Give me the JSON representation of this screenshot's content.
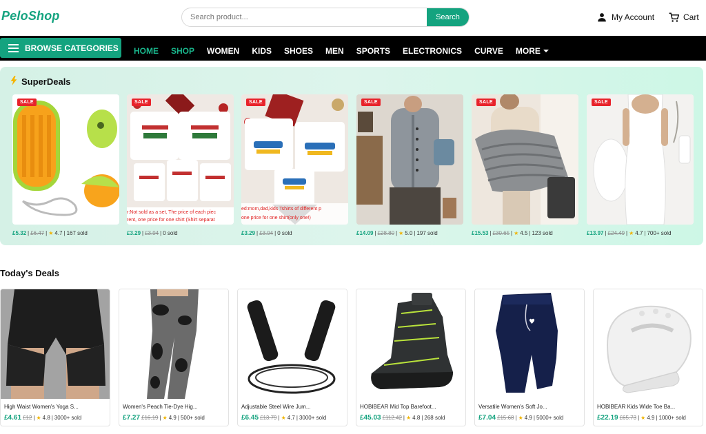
{
  "header": {
    "logo": "PeloShop",
    "search_placeholder": "Search product...",
    "search_button": "Search",
    "account_label": "My Account",
    "cart_label": "Cart"
  },
  "nav": {
    "browse_label": "BROWSE CATEGORIES",
    "items": [
      "HOME",
      "SHOP",
      "WOMEN",
      "KIDS",
      "SHOES",
      "MEN",
      "SPORTS",
      "ELECTRONICS",
      "CURVE",
      "MORE"
    ],
    "active_items": [
      "HOME",
      "SHOP"
    ]
  },
  "superdeals": {
    "title": "SuperDeals",
    "badge": "SALE",
    "items": [
      {
        "price": "£5.32",
        "old_price": "£6.47",
        "rating": "4.7",
        "sold": "167 sold",
        "image": "steam-pet-brush"
      },
      {
        "price": "£3.29",
        "old_price": "£3.94",
        "rating": "",
        "sold": "0 sold",
        "image": "family-christmas-tshirts",
        "overlay": "r:Not sold as a set, The price of each piec\nrent, one price for one shirt (Shirt separat"
      },
      {
        "price": "£3.29",
        "old_price": "£3.94",
        "rating": "",
        "sold": "0 sold",
        "image": "hello-2026-tshirts",
        "overlay": "ed:mom,dad,kids Tshirts of different p\none price for one shirt(only one!)"
      },
      {
        "price": "£14.09",
        "old_price": "£28.80",
        "rating": "5.0",
        "sold": "197 sold",
        "image": "grey-cardigan"
      },
      {
        "price": "£15.53",
        "old_price": "£30.65",
        "rating": "4.5",
        "sold": "123 sold",
        "image": "grey-blanket"
      },
      {
        "price": "£13.97",
        "old_price": "£24.49",
        "rating": "4.7",
        "sold": "700+ sold",
        "image": "white-dress"
      }
    ]
  },
  "todays_deals": {
    "title": "Today's Deals",
    "items": [
      {
        "name": "High Waist Women's Yoga S...",
        "price": "£4.61",
        "old_price": "£12",
        "rating": "4.8",
        "sold": "3000+ sold",
        "image": "black-yoga-shorts"
      },
      {
        "name": "Women's Peach Tie-Dye Hig...",
        "price": "£7.27",
        "old_price": "£16.19",
        "rating": "4.9",
        "sold": "500+ sold",
        "image": "tie-dye-leggings"
      },
      {
        "name": "Adjustable Steel Wire Jum...",
        "price": "£6.45",
        "old_price": "£13.79",
        "rating": "4.7",
        "sold": "3000+ sold",
        "image": "jump-rope"
      },
      {
        "name": "HOBIBEAR Mid Top Barefoot...",
        "price": "£45.03",
        "old_price": "£112.42",
        "rating": "4.8",
        "sold": "268 sold",
        "image": "hiking-shoe"
      },
      {
        "name": "Versatile Women's Soft Jo...",
        "price": "£7.04",
        "old_price": "£15.68",
        "rating": "4.9",
        "sold": "5000+ sold",
        "image": "navy-joggers"
      },
      {
        "name": "HOBIBEAR Kids Wide Toe Ba...",
        "price": "£22.19",
        "old_price": "£65.73",
        "rating": "4.9",
        "sold": "1000+ sold",
        "image": "white-kids-shoe"
      }
    ]
  },
  "colors": {
    "brand": "#14a37f",
    "sale": "#e8232b",
    "nav_bg": "#000000",
    "superdeals_bg": "#d5f1e6"
  }
}
